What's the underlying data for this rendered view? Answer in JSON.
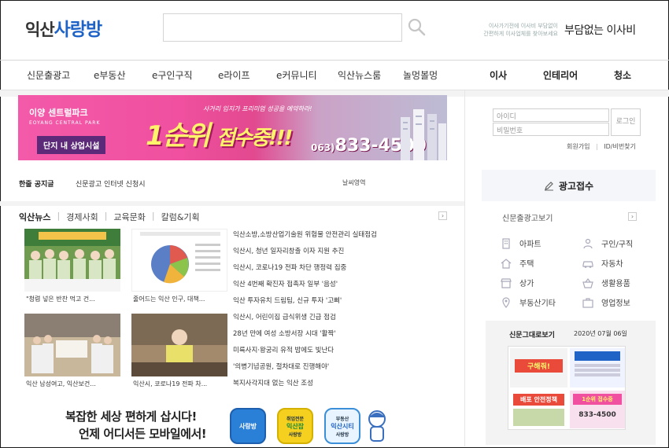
{
  "header": {
    "logo_part1": "익산",
    "logo_part2": "사랑방",
    "move_ad_small": "이사가기전에 이사비 부담없이 간편하게 이사업체를 찾아보세요",
    "move_ad_big": "부담없는 이사비"
  },
  "nav": {
    "items": [
      "신문출광고",
      "e부동산",
      "e구인구직",
      "e라이프",
      "e커뮤니티",
      "익산뉴스룸",
      "놀멍볼멍"
    ],
    "right_items": [
      "이사",
      "인테리어",
      "청소"
    ]
  },
  "banner": {
    "brand": "이양 센트럴파크",
    "brand_en": "EOYANG CENTRAL PARK",
    "tag": "단지 내 상업시설",
    "slogan": "사거리 입지가 프리미엄 성공을 예약하라!",
    "headline_a": "1순위",
    "headline_b": "접수중!!!",
    "phone_area": "063)",
    "phone_number": "833-4500"
  },
  "notice": {
    "label": "한줄 공지글",
    "text": "신문광고 인터넷 신청시",
    "weather": "날씨영역"
  },
  "news": {
    "tabs": [
      "익산뉴스",
      "경제사회",
      "교육문화",
      "칼럼&기획"
    ],
    "thumbs": [
      {
        "caption": "\"청렴 넣은 반찬 먹고 건..."
      },
      {
        "caption": "줄어드는 익산 인구, 대책..."
      },
      {
        "caption": "익산 남성여고, 익산보건..."
      },
      {
        "caption": "익산시, 코로나19 전파 차..."
      }
    ],
    "headlines": [
      "익산소방,소방산업기술원 위험물 안전관리 실태점검",
      "익산시, 청년 일자리창출 이자 지원 추진",
      "익산시, 코로나19 전파 차단 행정력 집중",
      "익산 4번째 확진자 접촉자 일부 '음성'",
      "익산 투자유치 드림팀, 신규 투자 '고삐'",
      "익산시, 어린이집 급식위생 긴급 점검",
      "28년 만에 여성 소방서장 시대 '활짝'",
      "미륵사지·왕궁리 유적 밤에도 빛난다",
      "'의병기념공원, 절차대로 진행해야'",
      "복지사각지대 없는 익산 조성"
    ],
    "chart_thumb_title": "익산 인구 연도별 통계"
  },
  "mobile": {
    "line1": "복잡한 세상 편하게 삽시다!",
    "line2": "언제 어디서든 모바일에서!",
    "app1": "사랑방",
    "app2_top": "취업전문",
    "app2_main": "익산잡",
    "app2_sub": "사랑방",
    "app3_top": "부동산",
    "app3_main": "익산시티",
    "app3_sub": "사랑방"
  },
  "login": {
    "id_placeholder": "아이디",
    "pw_placeholder": "비밀번호",
    "button": "로그인",
    "join": "회원가입",
    "find": "ID/비번찾기"
  },
  "ad_receive": "광고접수",
  "classified": {
    "title": "신문출광고보기",
    "left": [
      "아파트",
      "주택",
      "상가",
      "부동산기타"
    ],
    "right": [
      "구인/구직",
      "자동차",
      "생활용품",
      "영업정보"
    ]
  },
  "paper": {
    "title": "신문그대로보기",
    "date": "2020년 07월 06일",
    "promo1": "구해줘!",
    "promo2": "배포 안전정책",
    "promo3": "1순위 접수중",
    "phone": "833-4500"
  },
  "colors": {
    "brand_blue": "#1f63c6",
    "banner_pink": "#f0509f",
    "banner_yellow": "#fff36b"
  }
}
